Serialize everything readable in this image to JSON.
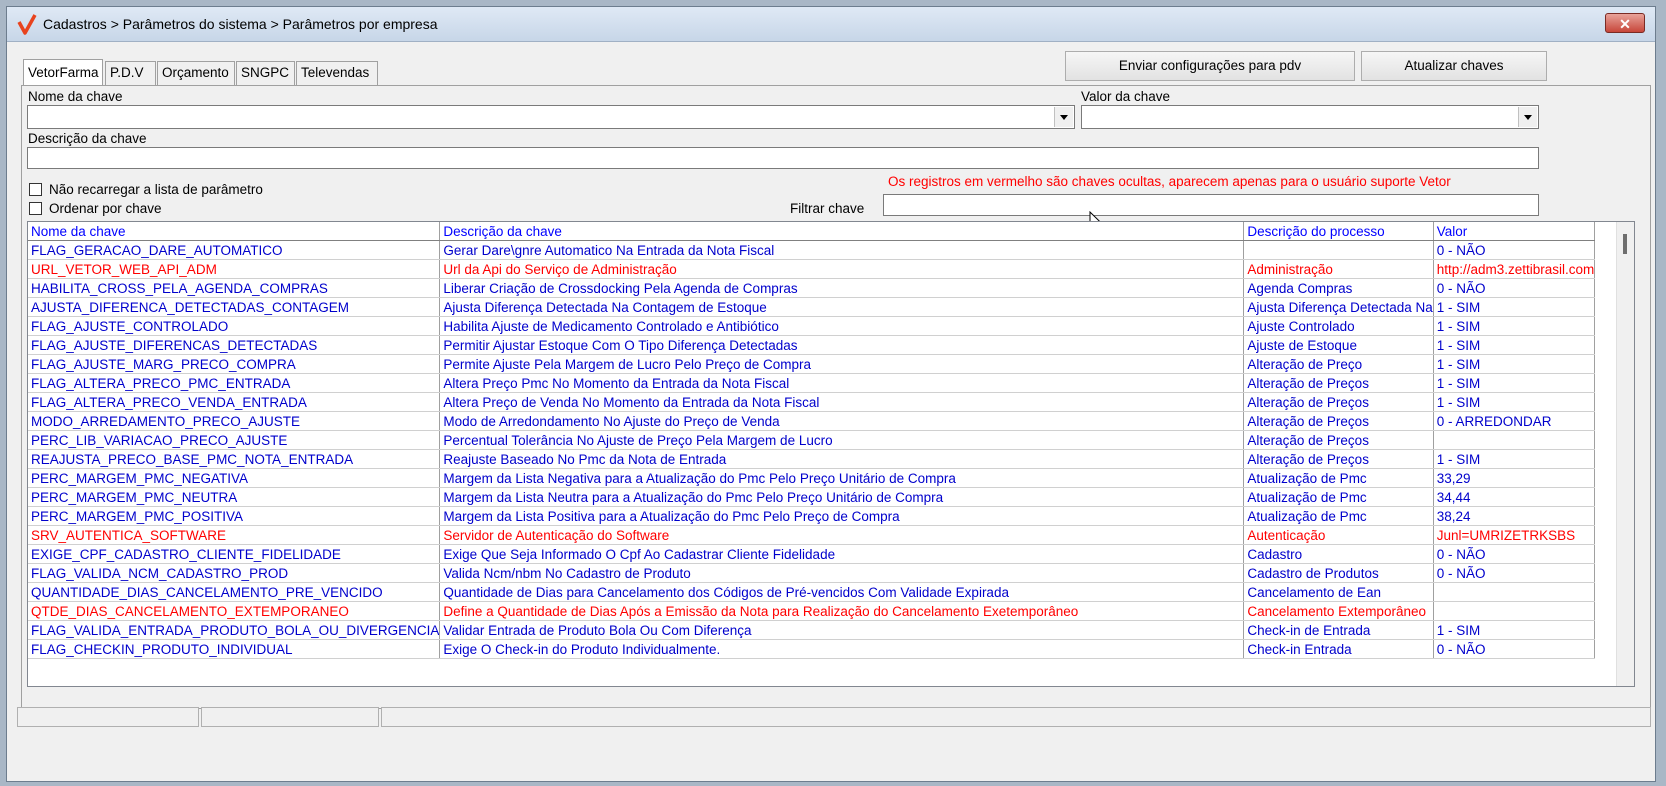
{
  "window": {
    "title": "Cadastros > Parâmetros do sistema > Parâmetros por empresa",
    "close_label": "✕"
  },
  "tabs": [
    "VetorFarma",
    "P.D.V",
    "Orçamento",
    "SNGPC",
    "Televendas"
  ],
  "toolbar": {
    "send_config_label": "Enviar configurações para  pdv",
    "update_keys_label": "Atualizar chaves"
  },
  "form": {
    "key_name_label": "Nome da chave",
    "key_value_label": "Valor da chave",
    "key_description_label": "Descrição da chave",
    "no_reload_label": "Não recarregar a lista de parâmetro",
    "sort_by_key_label": "Ordenar por chave",
    "filter_label": "Filtrar chave",
    "warning": "Os registros em vermelho são chaves ocultas, aparecem apenas para o usuário suporte Vetor"
  },
  "grid": {
    "columns": [
      "Nome da chave",
      "Descrição  da chave",
      "Descrição do processo",
      "Valor"
    ],
    "rows": [
      {
        "hidden": false,
        "cells": [
          "FLAG_GERACAO_DARE_AUTOMATICO",
          "Gerar Dare\\gnre Automatico Na Entrada da Nota Fiscal",
          "",
          "0 - NÃO"
        ]
      },
      {
        "hidden": true,
        "cells": [
          "URL_VETOR_WEB_API_ADM",
          "Url da Api do Serviço de Administração",
          "Administração",
          "http://adm3.zettibrasil.com"
        ]
      },
      {
        "hidden": false,
        "cells": [
          "HABILITA_CROSS_PELA_AGENDA_COMPRAS",
          "Liberar Criação de Crossdocking Pela Agenda de Compras",
          "Agenda Compras",
          "0 - NÃO"
        ]
      },
      {
        "hidden": false,
        "cells": [
          "AJUSTA_DIFERENCA_DETECTADAS_CONTAGEM",
          "Ajusta Diferença Detectada Na Contagem de Estoque",
          "Ajusta Diferença Detectada Na",
          "1 - SIM"
        ]
      },
      {
        "hidden": false,
        "cells": [
          "FLAG_AJUSTE_CONTROLADO",
          "Habilita Ajuste de Medicamento Controlado e Antibiótico",
          "Ajuste Controlado",
          "1 - SIM"
        ]
      },
      {
        "hidden": false,
        "cells": [
          "FLAG_AJUSTE_DIFERENCAS_DETECTADAS",
          "Permitir Ajustar Estoque Com O Tipo Diferença Detectadas",
          "Ajuste de Estoque",
          "1 - SIM"
        ]
      },
      {
        "hidden": false,
        "cells": [
          "FLAG_AJUSTE_MARG_PRECO_COMPRA",
          "Permite Ajuste Pela Margem de Lucro Pelo Preço de Compra",
          "Alteração de Preço",
          "1 - SIM"
        ]
      },
      {
        "hidden": false,
        "cells": [
          "FLAG_ALTERA_PRECO_PMC_ENTRADA",
          "Altera Preço Pmc No Momento da Entrada da Nota Fiscal",
          "Alteração de Preços",
          "1 - SIM"
        ]
      },
      {
        "hidden": false,
        "cells": [
          "FLAG_ALTERA_PRECO_VENDA_ENTRADA",
          "Altera Preço de Venda No Momento da Entrada da Nota Fiscal",
          "Alteração de Preços",
          "1 - SIM"
        ]
      },
      {
        "hidden": false,
        "cells": [
          "MODO_ARREDAMENTO_PRECO_AJUSTE",
          "Modo de Arredondamento No Ajuste do Preço de Venda",
          "Alteração de Preços",
          "0 - ARREDONDAR"
        ]
      },
      {
        "hidden": false,
        "cells": [
          "PERC_LIB_VARIACAO_PRECO_AJUSTE",
          "Percentual Tolerância No Ajuste de Preço Pela Margem de Lucro",
          "Alteração de Preços",
          ""
        ]
      },
      {
        "hidden": false,
        "cells": [
          "REAJUSTA_PRECO_BASE_PMC_NOTA_ENTRADA",
          "Reajuste Baseado No Pmc da Nota de Entrada",
          "Alteração de Preços",
          "1 - SIM"
        ]
      },
      {
        "hidden": false,
        "cells": [
          "PERC_MARGEM_PMC_NEGATIVA",
          "Margem da Lista Negativa para a Atualização do Pmc Pelo Preço Unitário de Compra",
          "Atualização de Pmc",
          "33,29"
        ]
      },
      {
        "hidden": false,
        "cells": [
          "PERC_MARGEM_PMC_NEUTRA",
          "Margem da Lista Neutra para a Atualização do Pmc Pelo Preço Unitário de Compra",
          "Atualização de Pmc",
          "34,44"
        ]
      },
      {
        "hidden": false,
        "cells": [
          "PERC_MARGEM_PMC_POSITIVA",
          "Margem da Lista Positiva para a Atualização do Pmc Pelo Preço de Compra",
          "Atualização de Pmc",
          "38,24"
        ]
      },
      {
        "hidden": true,
        "cells": [
          "SRV_AUTENTICA_SOFTWARE",
          "Servidor de Autenticação do Software",
          "Autenticação",
          "Junl=UMRIZETRKSBS"
        ]
      },
      {
        "hidden": false,
        "cells": [
          "EXIGE_CPF_CADASTRO_CLIENTE_FIDELIDADE",
          "Exige Que Seja Informado O Cpf Ao Cadastrar Cliente Fidelidade",
          "Cadastro",
          "0 - NÃO"
        ]
      },
      {
        "hidden": false,
        "cells": [
          "FLAG_VALIDA_NCM_CADASTRO_PROD",
          "Valida Ncm/nbm No Cadastro de Produto",
          "Cadastro de Produtos",
          "0 - NÃO"
        ]
      },
      {
        "hidden": false,
        "cells": [
          "QUANTIDADE_DIAS_CANCELAMENTO_PRE_VENCIDO",
          "Quantidade de Dias para Cancelamento dos Códigos de Pré-vencidos Com Validade Expirada",
          "Cancelamento de Ean",
          ""
        ]
      },
      {
        "hidden": true,
        "cells": [
          "QTDE_DIAS_CANCELAMENTO_EXTEMPORANEO",
          "Define a Quantidade de Dias Após a Emissão da Nota para Realização do Cancelamento Exetemporâneo",
          "Cancelamento Extemporâneo",
          ""
        ]
      },
      {
        "hidden": false,
        "cells": [
          "FLAG_VALIDA_ENTRADA_PRODUTO_BOLA_OU_DIVERGENCIA",
          "Validar Entrada de Produto Bola Ou Com Diferença",
          "Check-in de Entrada",
          "1 - SIM"
        ]
      },
      {
        "hidden": false,
        "cells": [
          "FLAG_CHECKIN_PRODUTO_INDIVIDUAL",
          "Exige O Check-in do Produto Individualmente.",
          "Check-in Entrada",
          "0 - NÃO"
        ]
      }
    ]
  },
  "colors": {
    "normal_row": "#0000cc",
    "hidden_row": "#ff0000",
    "header_text": "#0000ff",
    "logo_accent": "#e8431e"
  }
}
